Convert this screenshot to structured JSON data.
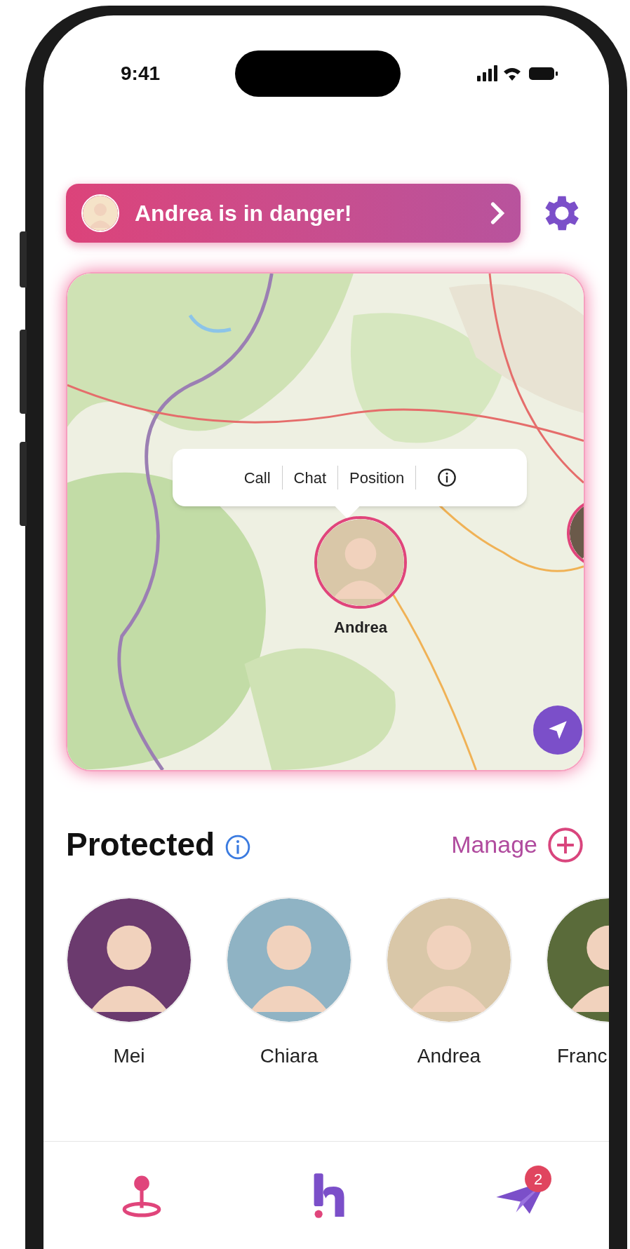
{
  "status_bar": {
    "time": "9:41"
  },
  "alert": {
    "text": "Andrea is in danger!"
  },
  "map": {
    "popup": {
      "actions": [
        "Call",
        "Chat",
        "Position"
      ]
    },
    "pin_label": "Andrea"
  },
  "protected": {
    "title": "Protected",
    "manage": "Manage",
    "people": [
      {
        "name": "Mei",
        "color": "#6b3a6e"
      },
      {
        "name": "Chiara",
        "color": "#8fb3c4"
      },
      {
        "name": "Andrea",
        "color": "#d9c7a8"
      },
      {
        "name": "Franc",
        "color": "#5a6b3a"
      }
    ]
  },
  "bottom_nav": {
    "items": [
      {
        "kind": "map"
      },
      {
        "kind": "logo"
      },
      {
        "kind": "messages",
        "badge": "2"
      }
    ]
  }
}
